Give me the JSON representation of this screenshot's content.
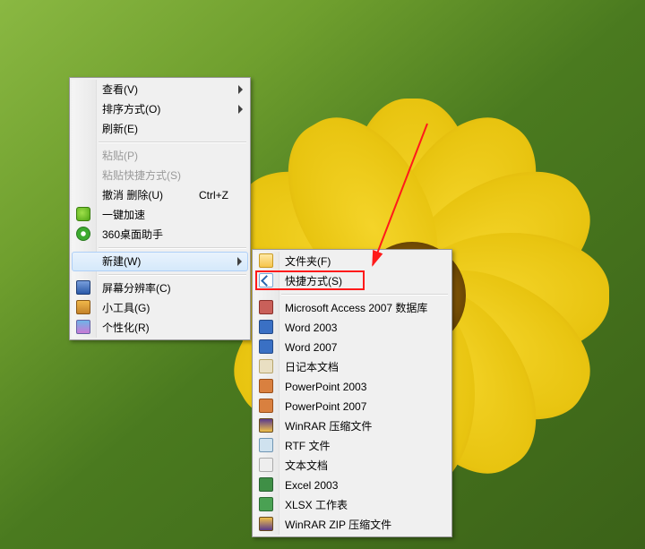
{
  "context_menu": {
    "view": {
      "label": "查看(V)",
      "has_sub": true
    },
    "sort": {
      "label": "排序方式(O)",
      "has_sub": true
    },
    "refresh": {
      "label": "刷新(E)"
    },
    "paste": {
      "label": "粘贴(P)",
      "disabled": true
    },
    "paste_shortcut": {
      "label": "粘贴快捷方式(S)",
      "disabled": true
    },
    "undo_delete": {
      "label": "撤消 删除(U)",
      "shortcut": "Ctrl+Z"
    },
    "speedup": {
      "label": "一键加速"
    },
    "desk_helper": {
      "label": "360桌面助手"
    },
    "new": {
      "label": "新建(W)",
      "has_sub": true,
      "hover": true
    },
    "resolution": {
      "label": "屏幕分辨率(C)"
    },
    "gadgets": {
      "label": "小工具(G)"
    },
    "personalize": {
      "label": "个性化(R)"
    }
  },
  "new_submenu": {
    "folder": {
      "label": "文件夹(F)"
    },
    "shortcut": {
      "label": "快捷方式(S)"
    },
    "access": {
      "label": "Microsoft Access 2007 数据库"
    },
    "word03": {
      "label": "Word 2003"
    },
    "word07": {
      "label": "Word 2007"
    },
    "diary": {
      "label": "日记本文档"
    },
    "ppt03": {
      "label": "PowerPoint 2003"
    },
    "ppt07": {
      "label": "PowerPoint 2007"
    },
    "winrar": {
      "label": "WinRAR 压缩文件"
    },
    "rtf": {
      "label": "RTF 文件"
    },
    "txt": {
      "label": "文本文档"
    },
    "excel03": {
      "label": "Excel 2003"
    },
    "xlsx": {
      "label": "XLSX 工作表"
    },
    "zip": {
      "label": "WinRAR ZIP 压缩文件"
    }
  },
  "annotation": {
    "highlight_target": "new_submenu.shortcut",
    "arrow_color": "#ff1a1a"
  }
}
